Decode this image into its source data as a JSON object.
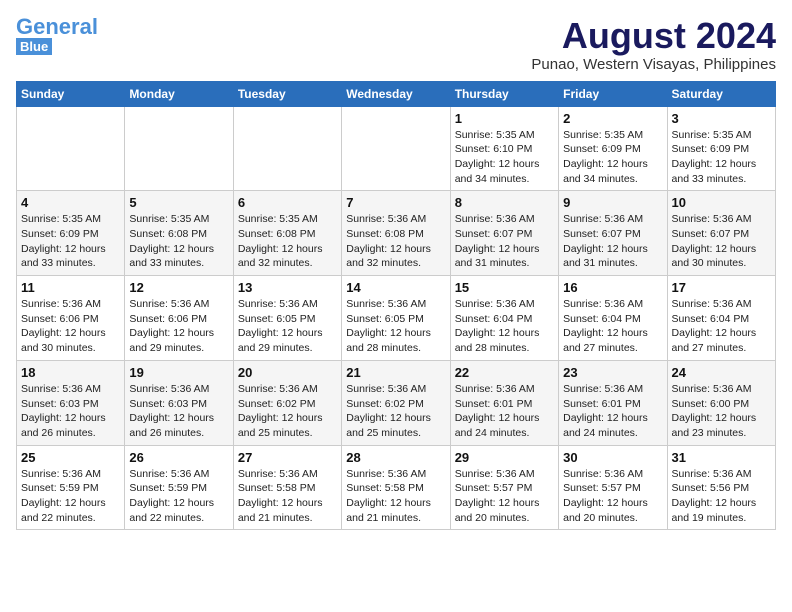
{
  "header": {
    "logo_general": "General",
    "logo_blue": "Blue",
    "month_year": "August 2024",
    "location": "Punao, Western Visayas, Philippines"
  },
  "weekdays": [
    "Sunday",
    "Monday",
    "Tuesday",
    "Wednesday",
    "Thursday",
    "Friday",
    "Saturday"
  ],
  "weeks": [
    [
      {
        "day": "",
        "info": ""
      },
      {
        "day": "",
        "info": ""
      },
      {
        "day": "",
        "info": ""
      },
      {
        "day": "",
        "info": ""
      },
      {
        "day": "1",
        "info": "Sunrise: 5:35 AM\nSunset: 6:10 PM\nDaylight: 12 hours\nand 34 minutes."
      },
      {
        "day": "2",
        "info": "Sunrise: 5:35 AM\nSunset: 6:09 PM\nDaylight: 12 hours\nand 34 minutes."
      },
      {
        "day": "3",
        "info": "Sunrise: 5:35 AM\nSunset: 6:09 PM\nDaylight: 12 hours\nand 33 minutes."
      }
    ],
    [
      {
        "day": "4",
        "info": "Sunrise: 5:35 AM\nSunset: 6:09 PM\nDaylight: 12 hours\nand 33 minutes."
      },
      {
        "day": "5",
        "info": "Sunrise: 5:35 AM\nSunset: 6:08 PM\nDaylight: 12 hours\nand 33 minutes."
      },
      {
        "day": "6",
        "info": "Sunrise: 5:35 AM\nSunset: 6:08 PM\nDaylight: 12 hours\nand 32 minutes."
      },
      {
        "day": "7",
        "info": "Sunrise: 5:36 AM\nSunset: 6:08 PM\nDaylight: 12 hours\nand 32 minutes."
      },
      {
        "day": "8",
        "info": "Sunrise: 5:36 AM\nSunset: 6:07 PM\nDaylight: 12 hours\nand 31 minutes."
      },
      {
        "day": "9",
        "info": "Sunrise: 5:36 AM\nSunset: 6:07 PM\nDaylight: 12 hours\nand 31 minutes."
      },
      {
        "day": "10",
        "info": "Sunrise: 5:36 AM\nSunset: 6:07 PM\nDaylight: 12 hours\nand 30 minutes."
      }
    ],
    [
      {
        "day": "11",
        "info": "Sunrise: 5:36 AM\nSunset: 6:06 PM\nDaylight: 12 hours\nand 30 minutes."
      },
      {
        "day": "12",
        "info": "Sunrise: 5:36 AM\nSunset: 6:06 PM\nDaylight: 12 hours\nand 29 minutes."
      },
      {
        "day": "13",
        "info": "Sunrise: 5:36 AM\nSunset: 6:05 PM\nDaylight: 12 hours\nand 29 minutes."
      },
      {
        "day": "14",
        "info": "Sunrise: 5:36 AM\nSunset: 6:05 PM\nDaylight: 12 hours\nand 28 minutes."
      },
      {
        "day": "15",
        "info": "Sunrise: 5:36 AM\nSunset: 6:04 PM\nDaylight: 12 hours\nand 28 minutes."
      },
      {
        "day": "16",
        "info": "Sunrise: 5:36 AM\nSunset: 6:04 PM\nDaylight: 12 hours\nand 27 minutes."
      },
      {
        "day": "17",
        "info": "Sunrise: 5:36 AM\nSunset: 6:04 PM\nDaylight: 12 hours\nand 27 minutes."
      }
    ],
    [
      {
        "day": "18",
        "info": "Sunrise: 5:36 AM\nSunset: 6:03 PM\nDaylight: 12 hours\nand 26 minutes."
      },
      {
        "day": "19",
        "info": "Sunrise: 5:36 AM\nSunset: 6:03 PM\nDaylight: 12 hours\nand 26 minutes."
      },
      {
        "day": "20",
        "info": "Sunrise: 5:36 AM\nSunset: 6:02 PM\nDaylight: 12 hours\nand 25 minutes."
      },
      {
        "day": "21",
        "info": "Sunrise: 5:36 AM\nSunset: 6:02 PM\nDaylight: 12 hours\nand 25 minutes."
      },
      {
        "day": "22",
        "info": "Sunrise: 5:36 AM\nSunset: 6:01 PM\nDaylight: 12 hours\nand 24 minutes."
      },
      {
        "day": "23",
        "info": "Sunrise: 5:36 AM\nSunset: 6:01 PM\nDaylight: 12 hours\nand 24 minutes."
      },
      {
        "day": "24",
        "info": "Sunrise: 5:36 AM\nSunset: 6:00 PM\nDaylight: 12 hours\nand 23 minutes."
      }
    ],
    [
      {
        "day": "25",
        "info": "Sunrise: 5:36 AM\nSunset: 5:59 PM\nDaylight: 12 hours\nand 22 minutes."
      },
      {
        "day": "26",
        "info": "Sunrise: 5:36 AM\nSunset: 5:59 PM\nDaylight: 12 hours\nand 22 minutes."
      },
      {
        "day": "27",
        "info": "Sunrise: 5:36 AM\nSunset: 5:58 PM\nDaylight: 12 hours\nand 21 minutes."
      },
      {
        "day": "28",
        "info": "Sunrise: 5:36 AM\nSunset: 5:58 PM\nDaylight: 12 hours\nand 21 minutes."
      },
      {
        "day": "29",
        "info": "Sunrise: 5:36 AM\nSunset: 5:57 PM\nDaylight: 12 hours\nand 20 minutes."
      },
      {
        "day": "30",
        "info": "Sunrise: 5:36 AM\nSunset: 5:57 PM\nDaylight: 12 hours\nand 20 minutes."
      },
      {
        "day": "31",
        "info": "Sunrise: 5:36 AM\nSunset: 5:56 PM\nDaylight: 12 hours\nand 19 minutes."
      }
    ]
  ]
}
